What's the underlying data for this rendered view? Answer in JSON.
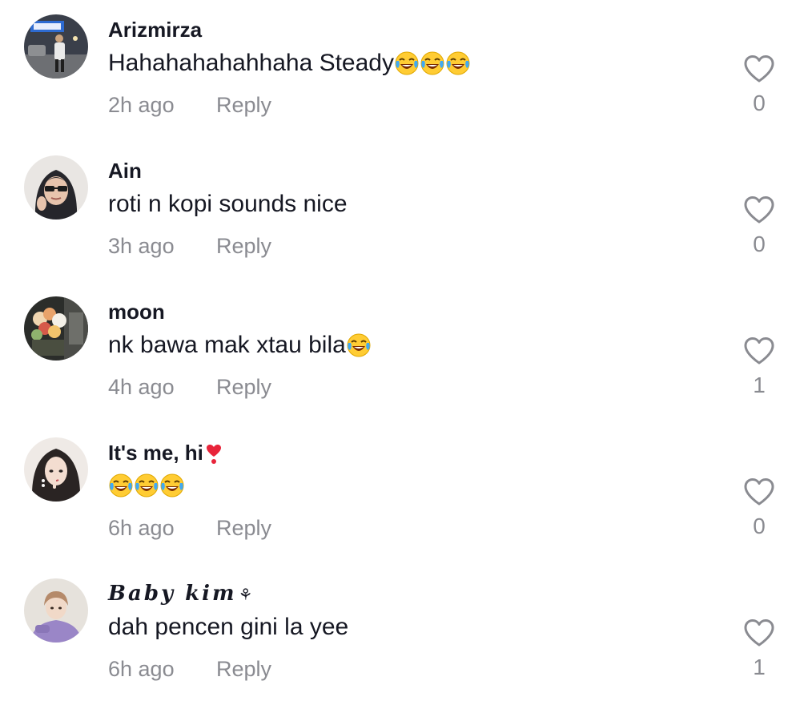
{
  "comments": [
    {
      "username": "Arizmirza",
      "text": "Hahahahahahhaha Steady",
      "emojis": [
        "joy-emoji",
        "joy-emoji",
        "joy-emoji"
      ],
      "time": "2h ago",
      "reply_label": "Reply",
      "likes": "0"
    },
    {
      "username": "Ain",
      "text": "roti n kopi sounds nice",
      "emojis": [],
      "time": "3h ago",
      "reply_label": "Reply",
      "likes": "0"
    },
    {
      "username": "moon",
      "text": "nk bawa mak xtau bila",
      "emojis": [
        "joy-emoji"
      ],
      "time": "4h ago",
      "reply_label": "Reply",
      "likes": "1"
    },
    {
      "username": "It's me, hi",
      "username_emoji": "heart-exclamation-emoji",
      "text": "",
      "emojis": [
        "joy-emoji",
        "joy-emoji",
        "joy-emoji"
      ],
      "time": "6h ago",
      "reply_label": "Reply",
      "likes": "0"
    },
    {
      "username": "Baby kim",
      "username_suffix": "⚘",
      "text": "dah pencen gini la yee",
      "emojis": [],
      "time": "6h ago",
      "reply_label": "Reply",
      "likes": "1"
    }
  ],
  "colors": {
    "primary_text": "#161823",
    "secondary_text": "#8a8b91",
    "heart_outline": "#8a8b91"
  }
}
